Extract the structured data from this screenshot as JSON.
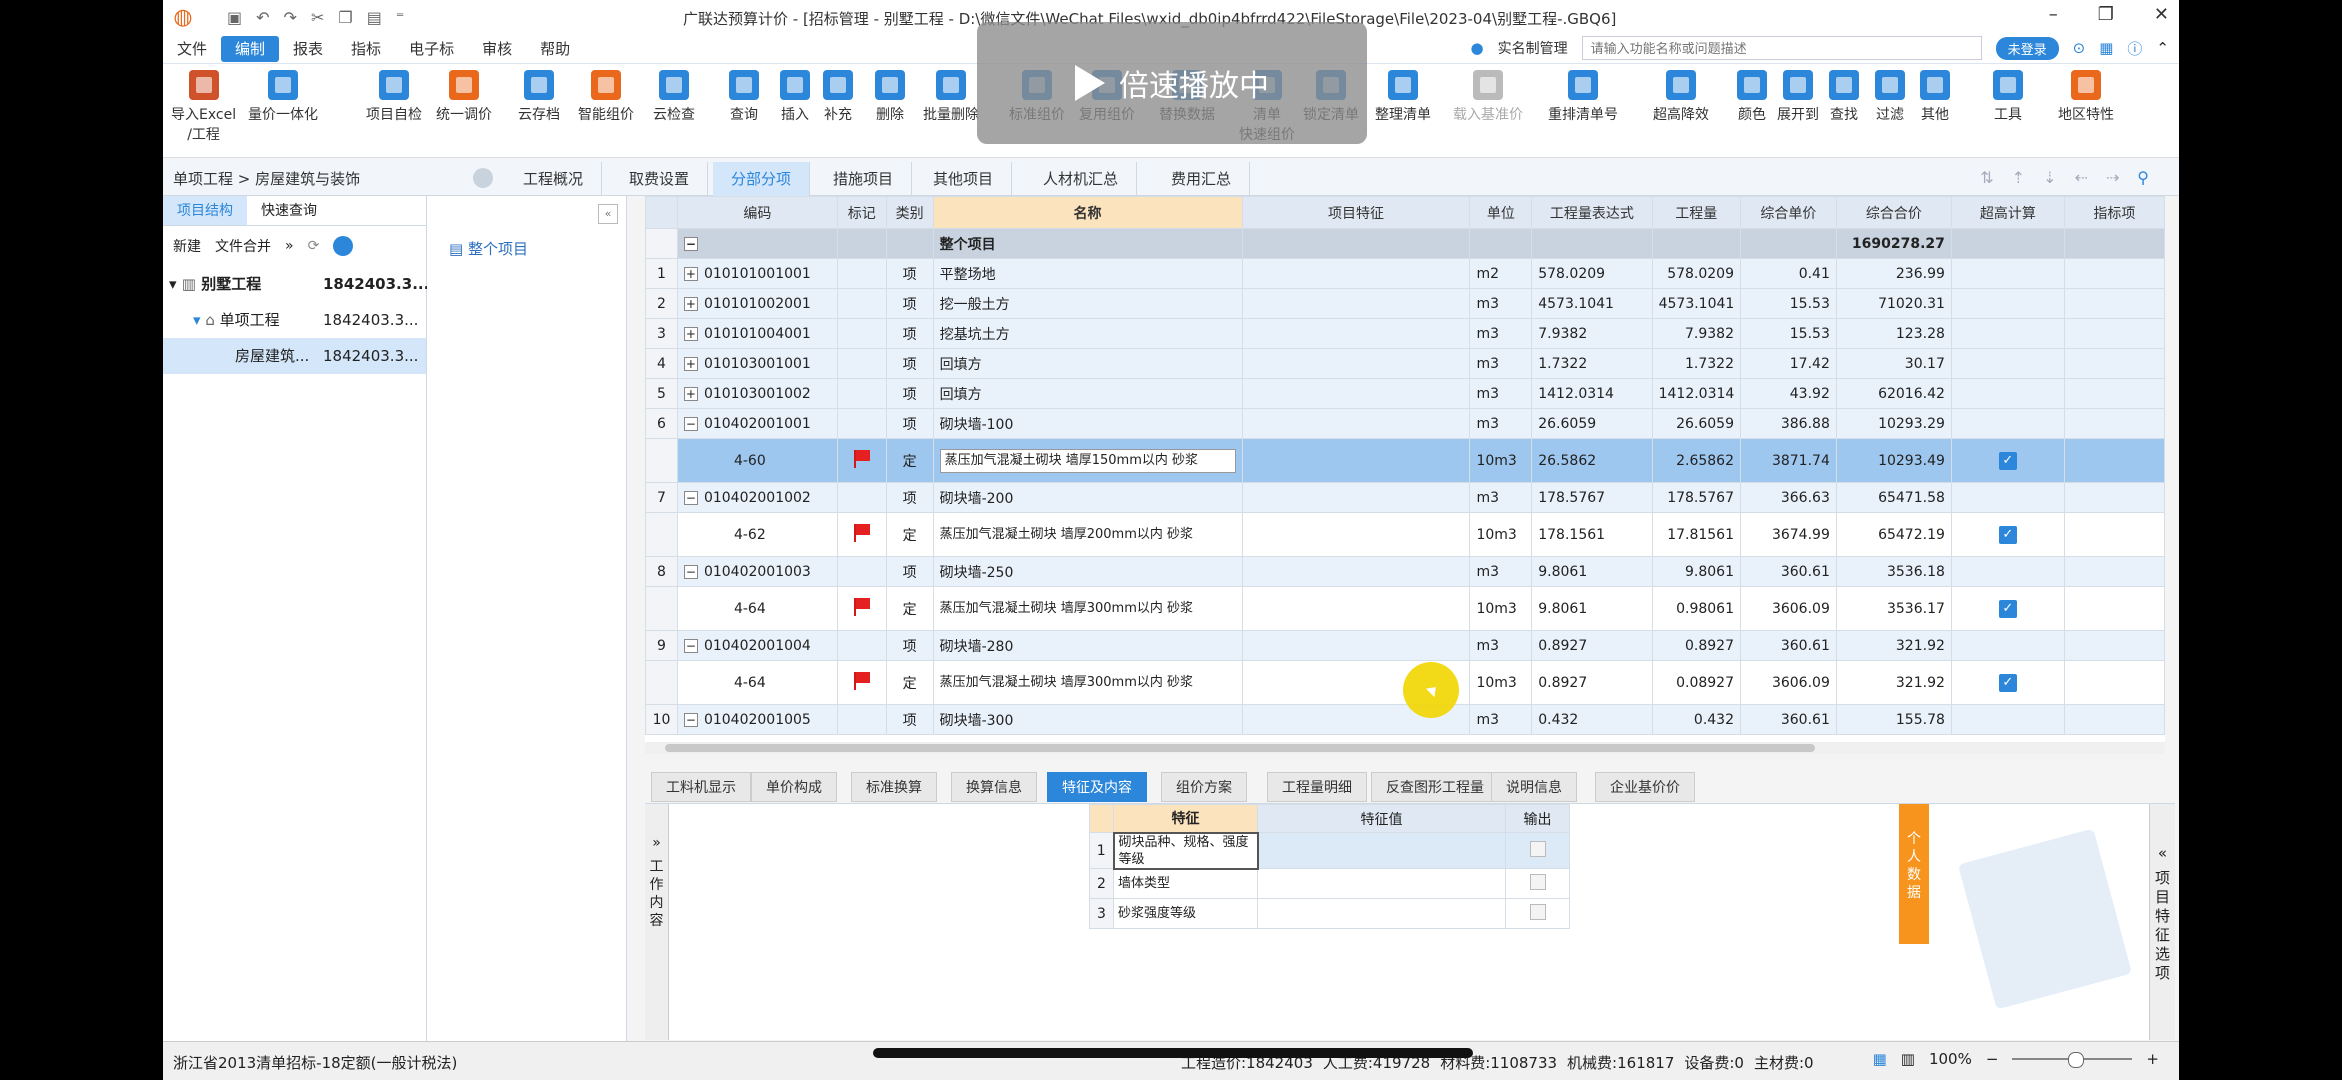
{
  "window": {
    "title": "广联达预算计价 - [招标管理 - 别墅工程 - D:\\微信文件\\WeChat Files\\wxid_db0ip4bfrrd422\\FileStorage\\File\\2023-04\\别墅工程-.GBQ6]"
  },
  "menu": {
    "items": [
      "文件",
      "编制",
      "报表",
      "指标",
      "电子标",
      "审核",
      "帮助"
    ],
    "active": "编制",
    "realname": "实名制管理",
    "search_placeholder": "请输入功能名称或问题描述",
    "login": "未登录"
  },
  "ribbon": {
    "buttons": [
      {
        "l1": "导入Excel",
        "l2": "/工程"
      },
      {
        "l1": "量价一体化",
        "l2": ""
      },
      {
        "l1": "项目自检",
        "l2": ""
      },
      {
        "l1": "统一调价",
        "l2": ""
      },
      {
        "l1": "云存档",
        "l2": ""
      },
      {
        "l1": "智能组价",
        "l2": ""
      },
      {
        "l1": "云检查",
        "l2": ""
      },
      {
        "l1": "查询",
        "l2": ""
      },
      {
        "l1": "插入",
        "l2": ""
      },
      {
        "l1": "补充",
        "l2": ""
      },
      {
        "l1": "删除",
        "l2": ""
      },
      {
        "l1": "批量删除",
        "l2": ""
      },
      {
        "l1": "标准组价",
        "l2": ""
      },
      {
        "l1": "复用组价",
        "l2": ""
      },
      {
        "l1": "替换数据",
        "l2": ""
      },
      {
        "l1": "清单",
        "l2": "快速组价"
      },
      {
        "l1": "锁定清单",
        "l2": ""
      },
      {
        "l1": "整理清单",
        "l2": ""
      },
      {
        "l1": "载入基准价",
        "l2": ""
      },
      {
        "l1": "重排清单号",
        "l2": ""
      },
      {
        "l1": "超高降效",
        "l2": ""
      },
      {
        "l1": "颜色",
        "l2": ""
      },
      {
        "l1": "展开到",
        "l2": ""
      },
      {
        "l1": "查找",
        "l2": ""
      },
      {
        "l1": "过滤",
        "l2": ""
      },
      {
        "l1": "其他",
        "l2": ""
      },
      {
        "l1": "工具",
        "l2": ""
      },
      {
        "l1": "地区特性",
        "l2": ""
      }
    ],
    "overlay_text": "倍速播放中"
  },
  "location": {
    "breadcrumb": "单项工程 > 房屋建筑与装饰",
    "tabs": [
      "工程概况",
      "取费设置",
      "分部分项",
      "措施项目",
      "其他项目",
      "人材机汇总",
      "费用汇总"
    ],
    "active_tab": "分部分项"
  },
  "left": {
    "tabs": [
      "项目结构",
      "快速查询"
    ],
    "toolbar": [
      "新建",
      "文件合并",
      "»"
    ],
    "tree": [
      {
        "label": "别墅工程",
        "value": "1842403.3..."
      },
      {
        "label": "单项工程",
        "value": "1842403.3..."
      },
      {
        "label": "房屋建筑...",
        "value": "1842403.3..."
      }
    ],
    "mid_item": "整个项目"
  },
  "grid": {
    "headers": [
      "编码",
      "标记",
      "类别",
      "名称",
      "项目特征",
      "单位",
      "工程量表达式",
      "工程量",
      "综合单价",
      "综合合价",
      "超高计算",
      "指标项"
    ],
    "whole": {
      "name": "整个项目",
      "total": "1690278.27"
    },
    "rows": [
      {
        "t": "item",
        "n": "1",
        "code": "010101001001",
        "sign": "+",
        "cat": "项",
        "name": "平整场地",
        "unit": "m2",
        "expr": "578.0209",
        "qty": "578.0209",
        "price": "0.41",
        "total": "236.99"
      },
      {
        "t": "item",
        "n": "2",
        "code": "010101002001",
        "sign": "+",
        "cat": "项",
        "name": "挖一般土方",
        "unit": "m3",
        "expr": "4573.1041",
        "qty": "4573.1041",
        "price": "15.53",
        "total": "71020.31"
      },
      {
        "t": "item",
        "n": "3",
        "code": "010101004001",
        "sign": "+",
        "cat": "项",
        "name": "挖基坑土方",
        "unit": "m3",
        "expr": "7.9382",
        "qty": "7.9382",
        "price": "15.53",
        "total": "123.28"
      },
      {
        "t": "item",
        "n": "4",
        "code": "010103001001",
        "sign": "+",
        "cat": "项",
        "name": "回填方",
        "unit": "m3",
        "expr": "1.7322",
        "qty": "1.7322",
        "price": "17.42",
        "total": "30.17"
      },
      {
        "t": "item",
        "n": "5",
        "code": "010103001002",
        "sign": "+",
        "cat": "项",
        "name": "回填方",
        "unit": "m3",
        "expr": "1412.0314",
        "qty": "1412.0314",
        "price": "43.92",
        "total": "62016.42"
      },
      {
        "t": "item",
        "n": "6",
        "code": "010402001001",
        "sign": "−",
        "cat": "项",
        "name": "砌块墙-100",
        "unit": "m3",
        "expr": "26.6059",
        "qty": "26.6059",
        "price": "386.88",
        "total": "10293.29"
      },
      {
        "t": "quota",
        "sel": true,
        "n": "",
        "code": "4-60",
        "cat": "定",
        "name": "蒸压加气混凝土砌块 墙厚150mm以内 砂浆",
        "unit": "10m3",
        "expr": "26.5862",
        "qty": "2.65862",
        "price": "3871.74",
        "total": "10293.49"
      },
      {
        "t": "item",
        "n": "7",
        "code": "010402001002",
        "sign": "−",
        "cat": "项",
        "name": "砌块墙-200",
        "unit": "m3",
        "expr": "178.5767",
        "qty": "178.5767",
        "price": "366.63",
        "total": "65471.58"
      },
      {
        "t": "quota",
        "n": "",
        "code": "4-62",
        "cat": "定",
        "name": "蒸压加气混凝土砌块 墙厚200mm以内 砂浆",
        "unit": "10m3",
        "expr": "178.1561",
        "qty": "17.81561",
        "price": "3674.99",
        "total": "65472.19"
      },
      {
        "t": "item",
        "n": "8",
        "code": "010402001003",
        "sign": "−",
        "cat": "项",
        "name": "砌块墙-250",
        "unit": "m3",
        "expr": "9.8061",
        "qty": "9.8061",
        "price": "360.61",
        "total": "3536.18"
      },
      {
        "t": "quota",
        "n": "",
        "code": "4-64",
        "cat": "定",
        "name": "蒸压加气混凝土砌块 墙厚300mm以内 砂浆",
        "unit": "10m3",
        "expr": "9.8061",
        "qty": "0.98061",
        "price": "3606.09",
        "total": "3536.17"
      },
      {
        "t": "item",
        "n": "9",
        "code": "010402001004",
        "sign": "−",
        "cat": "项",
        "name": "砌块墙-280",
        "unit": "m3",
        "expr": "0.8927",
        "qty": "0.8927",
        "price": "360.61",
        "total": "321.92"
      },
      {
        "t": "quota",
        "n": "",
        "code": "4-64",
        "cat": "定",
        "name": "蒸压加气混凝土砌块 墙厚300mm以内 砂浆",
        "unit": "10m3",
        "expr": "0.8927",
        "qty": "0.08927",
        "price": "3606.09",
        "total": "321.92"
      },
      {
        "t": "item",
        "n": "10",
        "code": "010402001005",
        "sign": "−",
        "cat": "项",
        "name": "砌块墙-300",
        "unit": "m3",
        "expr": "0.432",
        "qty": "0.432",
        "price": "360.61",
        "total": "155.78"
      }
    ]
  },
  "bottom": {
    "tabs": [
      "工料机显示",
      "单价构成",
      "标准换算",
      "换算信息",
      "特征及内容",
      "组价方案",
      "工程量明细",
      "反查图形工程量",
      "说明信息",
      "企业基价价"
    ],
    "active_tab": "特征及内容",
    "left_label": "工作内容",
    "feature_headers": [
      "特征",
      "特征值",
      "输出"
    ],
    "features": [
      {
        "n": "1",
        "name": "砌块品种、规格、强度等级"
      },
      {
        "n": "2",
        "name": "墙体类型"
      },
      {
        "n": "3",
        "name": "砂浆强度等级"
      }
    ],
    "side_label": "个人数据",
    "right_label": "项目特征选项"
  },
  "status": {
    "left": "浙江省2013清单招标-18定额(一般计税法)",
    "items": [
      "工程造价:1842403",
      "人工费:419728",
      "材料费:1108733",
      "机械费:161817",
      "设备费:0",
      "主材费:0"
    ],
    "zoom": "100%"
  },
  "colors": {
    "accent": "#2c86d9",
    "selected_row": "#9ec7ef",
    "flag": "#e52020",
    "overlay": "#8c8c8c"
  }
}
